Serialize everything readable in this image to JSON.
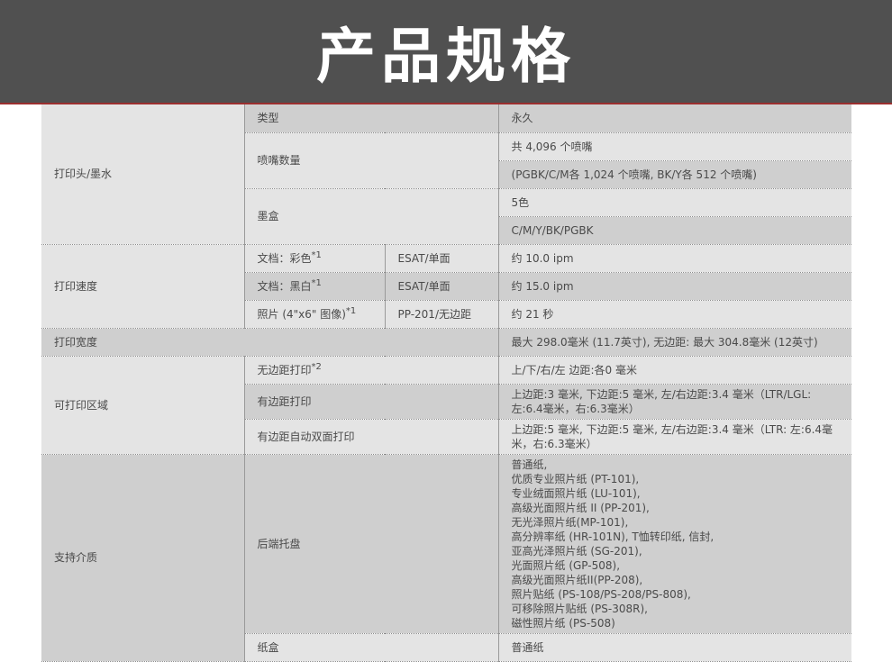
{
  "title": "产品规格",
  "rows": {
    "printhead": {
      "category": "打印头/墨水",
      "type_label": "类型",
      "type_value": "永久",
      "nozzles_label": "喷嘴数量",
      "nozzles_value_1": "共 4,096 个喷嘴",
      "nozzles_value_2": "(PGBK/C/M各 1,024 个喷嘴, BK/Y各 512 个喷嘴)",
      "ink_label": "墨盒",
      "ink_value_1": "5色",
      "ink_value_2": "C/M/Y/BK/PGBK"
    },
    "speed": {
      "category": "打印速度",
      "doc_color_label": "文档：彩色",
      "doc_color_mark": "*1",
      "doc_color_mode": "ESAT/单面",
      "doc_color_value": "约 10.0 ipm",
      "doc_mono_label": "文档：黑白",
      "doc_mono_mark": "*1",
      "doc_mono_mode": "ESAT/单面",
      "doc_mono_value": "约 15.0 ipm",
      "photo_label": "照片 (4\"x6\" 图像)",
      "photo_mark": "*1",
      "photo_mode": "PP-201/无边距",
      "photo_value": "约 21 秒"
    },
    "width": {
      "category": "打印宽度",
      "value": "最大 298.0毫米 (11.7英寸), 无边距: 最大 304.8毫米 (12英寸)"
    },
    "area": {
      "category": "可打印区域",
      "borderless_label": "无边距打印",
      "borderless_mark": "*2",
      "borderless_value": "上/下/右/左 边距:各0 毫米",
      "bordered_label": "有边距打印",
      "bordered_value": "上边距:3 毫米, 下边距:5 毫米, 左/右边距:3.4 毫米（LTR/LGL: 左:6.4毫米，右:6.3毫米）",
      "duplex_label": "有边距自动双面打印",
      "duplex_value": "上边距:5 毫米, 下边距:5 毫米, 左/右边距:3.4 毫米（LTR: 左:6.4毫米，右:6.3毫米）"
    },
    "media": {
      "category": "支持介质",
      "rear_tray_label": "后端托盘",
      "rear_tray_items": [
        "普通纸,",
        "优质专业照片纸 (PT-101),",
        "专业绒面照片纸 (LU-101),",
        "高级光面照片纸 II (PP-201),",
        "无光泽照片纸(MP-101),",
        "高分辨率纸 (HR-101N), T恤转印纸, 信封,",
        "亚高光泽照片纸 (SG-201),",
        "光面照片纸 (GP-508),",
        "高级光面照片纸II(PP-208),",
        "照片贴纸 (PS-108/PS-208/PS-808),",
        "可移除照片贴纸 (PS-308R),",
        "磁性照片纸 (PS-508)"
      ],
      "cassette_label": "纸盒",
      "cassette_value": "普通纸"
    }
  }
}
